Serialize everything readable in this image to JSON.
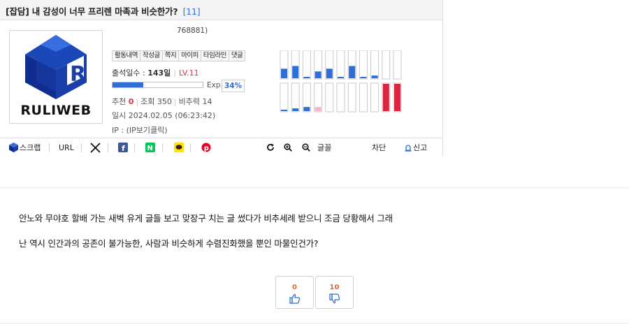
{
  "post": {
    "category": "[잡담]",
    "title": "내 감성이 너무 프리렌 마족과 비슷한가?",
    "comment_count": "[11]"
  },
  "author": {
    "logo_text": "RULIWEB",
    "id_text": "768881)",
    "menu": [
      "활동내역",
      "작성글",
      "쪽지",
      "마이피",
      "타임라인",
      "댓글"
    ],
    "attendance_label": "출석일수 :",
    "attendance_days": "143일",
    "level": "LV.11",
    "exp_label": "Exp.",
    "exp_percent": "34%",
    "exp_fraction": 0.34,
    "recommend_label": "추천",
    "recommend_value": "0",
    "views_label": "조회",
    "views_value": "350",
    "nonrec_label": "비추력",
    "nonrec_value": "14",
    "time_label": "일시",
    "time_value": "2024.02.05 (06:23:42)",
    "ip_label": "IP :",
    "ip_value": "(IP보기클릭)"
  },
  "activity_chart": {
    "top_row": [
      0.35,
      0.45,
      0.05,
      0.25,
      0.35,
      0.05,
      0.45,
      0.05,
      0.1,
      0,
      0
    ],
    "bottom_row": [
      0.05,
      0.1,
      0.15,
      0.15,
      0,
      0,
      0,
      0,
      0,
      1,
      1
    ],
    "colors": {
      "blue": "#2d6fd6",
      "pink": "#f3b8c8",
      "red": "#d9253f"
    }
  },
  "toolbar": {
    "scrap": "스크랩",
    "url": "URL",
    "font": "글꼴",
    "block": "차단",
    "report": "신고"
  },
  "content": {
    "lines": [
      "안노와 무야호 할배 가는 새벽 유게 글들 보고 맞장구 치는 글 썼다가 비추세례 받으니 조금 당황해서 그래",
      "난 역시 인간과의 공존이 불가능한, 사람과 비슷하게 수렴진화했을 뿐인 마물인건가?"
    ]
  },
  "votes": {
    "up": "0",
    "down": "10"
  },
  "colors": {
    "accent_blue": "#2d6fd6",
    "level_red": "#d8364b",
    "vote_count": "#e06a3a"
  }
}
